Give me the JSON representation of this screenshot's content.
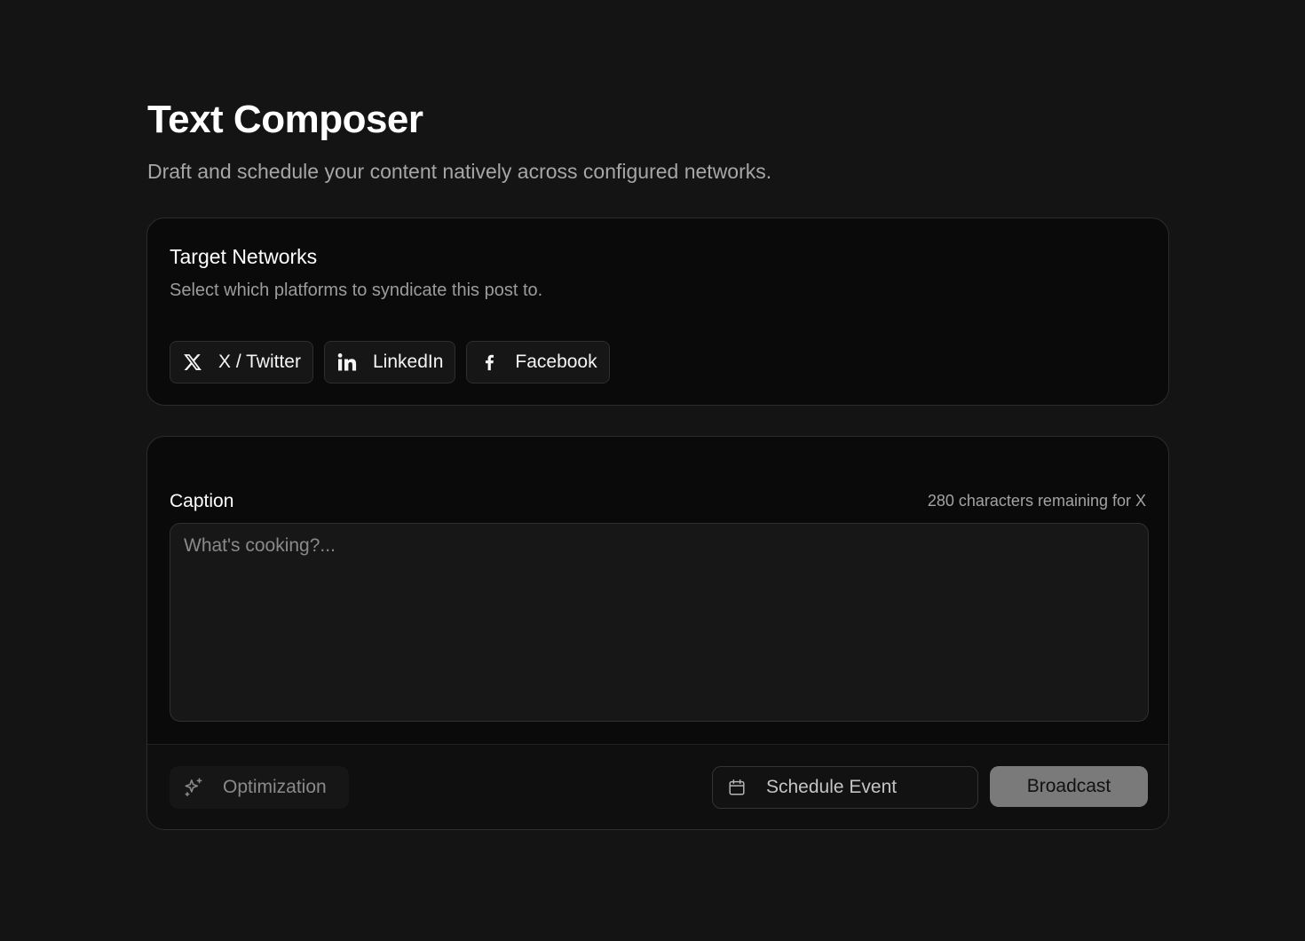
{
  "header": {
    "title": "Text Composer",
    "subtitle": "Draft and schedule your content natively across configured networks."
  },
  "networks": {
    "title": "Target Networks",
    "description": "Select which platforms to syndicate this post to.",
    "items": [
      {
        "label": "X / Twitter",
        "icon": "x-twitter-icon"
      },
      {
        "label": "LinkedIn",
        "icon": "linkedin-icon"
      },
      {
        "label": "Facebook",
        "icon": "facebook-icon"
      }
    ]
  },
  "composer": {
    "caption_label": "Caption",
    "char_count": "280 characters remaining for X",
    "caption_placeholder": "What's cooking?...",
    "caption_value": ""
  },
  "footer": {
    "optimization_label": "Optimization",
    "optimization_icon": "sparkles-icon",
    "schedule_label": "Schedule Event",
    "schedule_icon": "calendar-icon",
    "broadcast_label": "Broadcast"
  },
  "colors": {
    "background": "#141414",
    "card": "#0a0a0a",
    "broadcast_button": "#7a7a7a"
  }
}
